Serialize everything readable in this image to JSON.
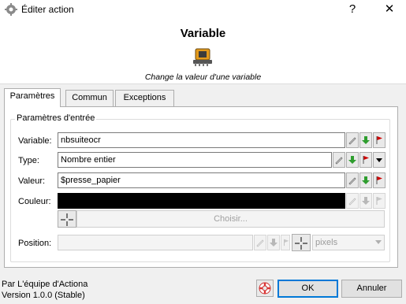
{
  "window": {
    "title": "Éditer action",
    "help_glyph": "?",
    "close_glyph": "✕"
  },
  "header": {
    "action_name": "Variable",
    "action_description": "Change la valeur d'une variable",
    "icon": "chip-icon"
  },
  "tabs": [
    {
      "label": "Paramètres",
      "active": true
    },
    {
      "label": "Commun",
      "active": false
    },
    {
      "label": "Exceptions",
      "active": false
    }
  ],
  "params": {
    "group_title": "Paramètres d'entrée",
    "variable": {
      "label": "Variable:",
      "value": "nbsuiteocr"
    },
    "type": {
      "label": "Type:",
      "value": "Nombre entier"
    },
    "valeur": {
      "label": "Valeur:",
      "value": "$presse_papier"
    },
    "couleur": {
      "label": "Couleur:",
      "value": "#000000",
      "choose_label": "Choisir..."
    },
    "position": {
      "label": "Position:",
      "value": "",
      "unit": "pixels"
    }
  },
  "footer": {
    "author": "Par L'équipe d'Actiona",
    "version": "Version 1.0.0 (Stable)",
    "ok_label": "OK",
    "cancel_label": "Annuler"
  },
  "colors": {
    "accent": "#0078d7",
    "green_arrow": "#2e9d2e",
    "red_flag": "#d00000"
  }
}
